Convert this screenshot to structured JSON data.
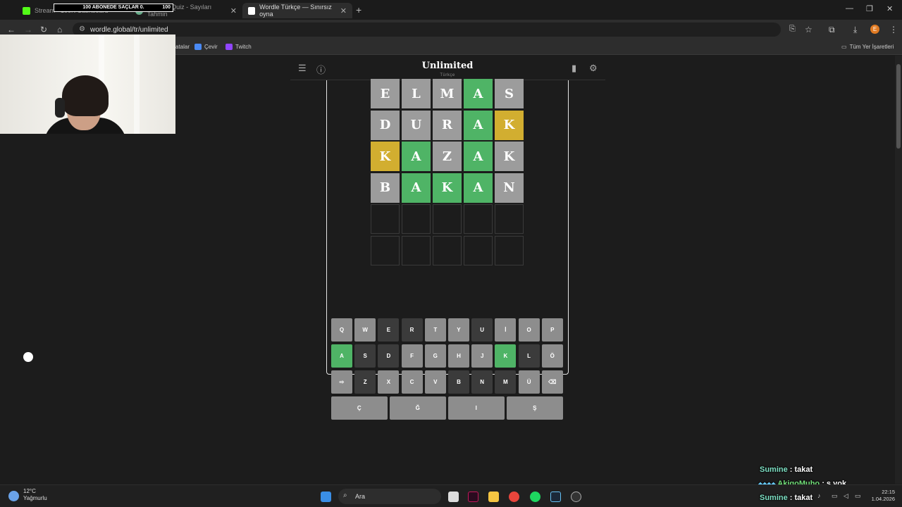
{
  "browser": {
    "tabs": [
      {
        "label": "Stream - 100K Cashboard",
        "active": false
      },
      {
        "label": "Number Quiz - Sayıları Tahmin",
        "active": false
      },
      {
        "label": "Wordle Türkçe — Sınırsız oyna",
        "active": true
      }
    ],
    "address": "wordle.global/tr/unlimited",
    "profile_initial": "E",
    "bookmarks": [
      "atalar",
      "Çevir",
      "Twitch"
    ],
    "all_bookmarks": "Tüm Yer İşaretleri"
  },
  "stream_overlay": {
    "text": "100 ABONEDE SAÇLAR 0.",
    "count": "100"
  },
  "game": {
    "title": "Unlimited",
    "subtitle": "Türkçe",
    "rows": [
      [
        {
          "l": "E",
          "s": "absent"
        },
        {
          "l": "L",
          "s": "absent"
        },
        {
          "l": "M",
          "s": "absent"
        },
        {
          "l": "A",
          "s": "correct"
        },
        {
          "l": "S",
          "s": "absent"
        }
      ],
      [
        {
          "l": "D",
          "s": "absent"
        },
        {
          "l": "U",
          "s": "absent"
        },
        {
          "l": "R",
          "s": "absent"
        },
        {
          "l": "A",
          "s": "correct"
        },
        {
          "l": "K",
          "s": "present"
        }
      ],
      [
        {
          "l": "K",
          "s": "present"
        },
        {
          "l": "A",
          "s": "correct"
        },
        {
          "l": "Z",
          "s": "absent"
        },
        {
          "l": "A",
          "s": "correct"
        },
        {
          "l": "K",
          "s": "absent"
        }
      ],
      [
        {
          "l": "B",
          "s": "absent"
        },
        {
          "l": "A",
          "s": "correct"
        },
        {
          "l": "K",
          "s": "correct"
        },
        {
          "l": "A",
          "s": "correct"
        },
        {
          "l": "N",
          "s": "absent"
        }
      ],
      [
        {
          "l": "",
          "s": "empty"
        },
        {
          "l": "",
          "s": "empty"
        },
        {
          "l": "",
          "s": "empty"
        },
        {
          "l": "",
          "s": "empty"
        },
        {
          "l": "",
          "s": "empty"
        }
      ],
      [
        {
          "l": "",
          "s": "empty"
        },
        {
          "l": "",
          "s": "empty"
        },
        {
          "l": "",
          "s": "empty"
        },
        {
          "l": "",
          "s": "empty"
        },
        {
          "l": "",
          "s": "empty"
        }
      ]
    ],
    "keyboard": [
      [
        {
          "k": "Q",
          "s": "u"
        },
        {
          "k": "W",
          "s": "u"
        },
        {
          "k": "E",
          "s": "a"
        },
        {
          "k": "R",
          "s": "a"
        },
        {
          "k": "T",
          "s": "u"
        },
        {
          "k": "Y",
          "s": "u"
        },
        {
          "k": "U",
          "s": "a"
        },
        {
          "k": "İ",
          "s": "u"
        },
        {
          "k": "O",
          "s": "u"
        },
        {
          "k": "P",
          "s": "u"
        }
      ],
      [
        {
          "k": "A",
          "s": "c"
        },
        {
          "k": "S",
          "s": "a"
        },
        {
          "k": "D",
          "s": "a"
        },
        {
          "k": "F",
          "s": "u"
        },
        {
          "k": "G",
          "s": "u"
        },
        {
          "k": "H",
          "s": "u"
        },
        {
          "k": "J",
          "s": "u"
        },
        {
          "k": "K",
          "s": "c"
        },
        {
          "k": "L",
          "s": "a"
        },
        {
          "k": "Ö",
          "s": "u"
        }
      ],
      [
        {
          "k": "⇨",
          "s": "u"
        },
        {
          "k": "Z",
          "s": "a"
        },
        {
          "k": "X",
          "s": "u"
        },
        {
          "k": "C",
          "s": "u"
        },
        {
          "k": "V",
          "s": "u"
        },
        {
          "k": "B",
          "s": "a"
        },
        {
          "k": "N",
          "s": "a"
        },
        {
          "k": "M",
          "s": "a"
        },
        {
          "k": "Ü",
          "s": "u"
        },
        {
          "k": "⌫",
          "s": "u"
        }
      ],
      [
        {
          "k": "Ç",
          "s": "u"
        },
        {
          "k": "Ğ",
          "s": "u"
        },
        {
          "k": "I",
          "s": "u"
        },
        {
          "k": "Ş",
          "s": "u"
        }
      ]
    ]
  },
  "chat": [
    {
      "user": "Sumine",
      "msg": " : takat"
    },
    {
      "user": "AkigoMuho",
      "msg": " : s yok"
    },
    {
      "user": "Sumine",
      "msg": " : takat"
    }
  ],
  "taskbar": {
    "weather_temp": "12°C",
    "weather_desc": "Yağmurlu",
    "search": "Ara",
    "time": "22:15",
    "date": "1.04.2026"
  },
  "colors": {
    "correct": "#4fb466",
    "present": "#d2ae30",
    "absent": "#9c9c9c"
  }
}
